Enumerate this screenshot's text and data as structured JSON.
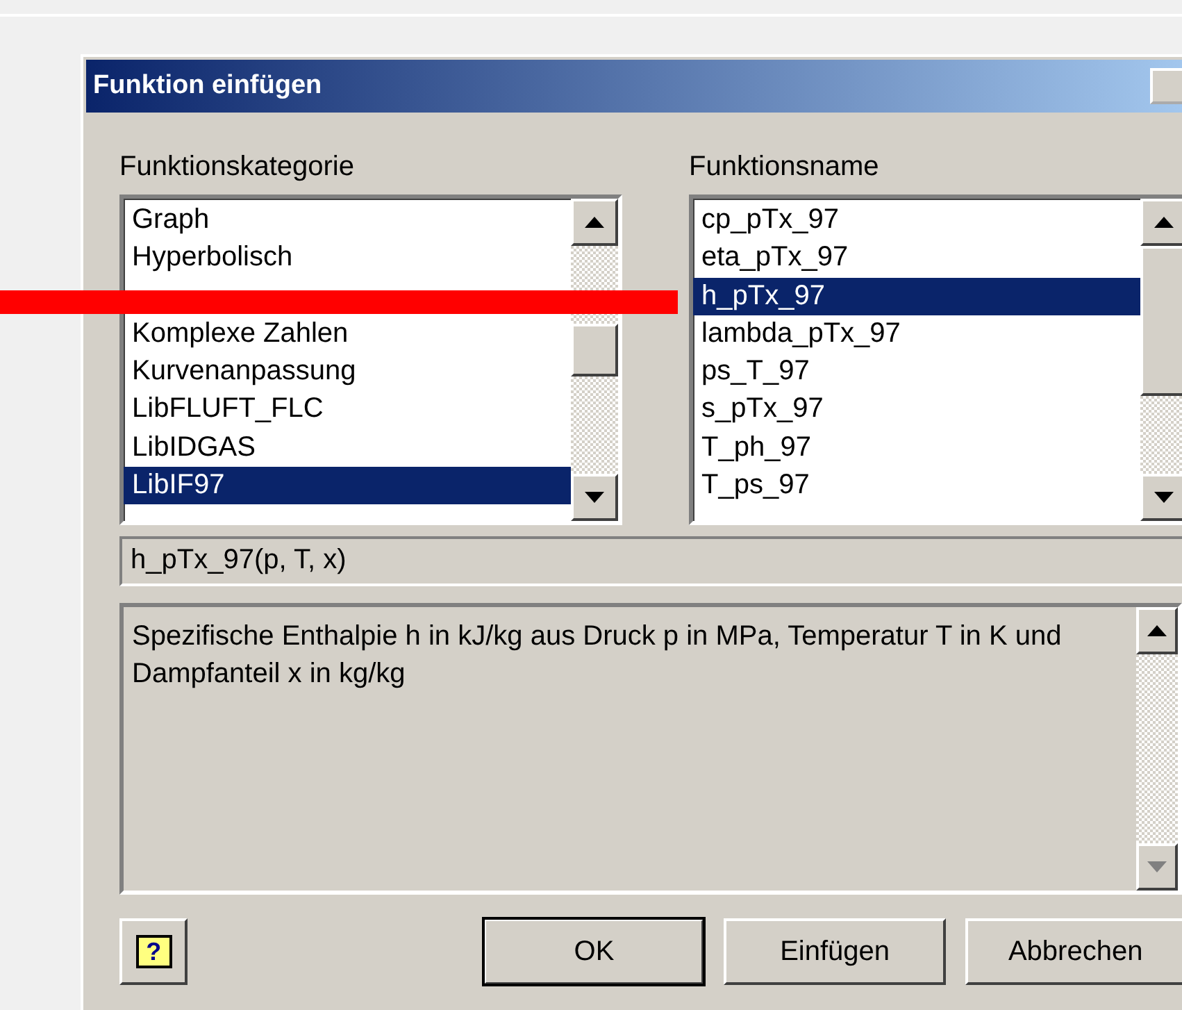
{
  "window": {
    "title": "Funktion einfügen"
  },
  "category_list": {
    "label": "Funktionskategorie",
    "items": [
      {
        "kind": "item",
        "label": "Graph",
        "selected": false
      },
      {
        "kind": "item",
        "label": "Hyperbolisch",
        "selected": false
      },
      {
        "kind": "covered"
      },
      {
        "kind": "item",
        "label": "Komplexe Zahlen",
        "selected": false
      },
      {
        "kind": "item",
        "label": "Kurvenanpassung",
        "selected": false
      },
      {
        "kind": "item",
        "label": "LibFLUFT_FLC",
        "selected": false
      },
      {
        "kind": "item",
        "label": "LibIDGAS",
        "selected": false
      },
      {
        "kind": "item",
        "label": "LibIF97",
        "selected": true
      }
    ]
  },
  "function_list": {
    "label": "Funktionsname",
    "items": [
      {
        "kind": "item",
        "label": "cp_pTx_97",
        "selected": false
      },
      {
        "kind": "item",
        "label": "eta_pTx_97",
        "selected": false
      },
      {
        "kind": "item",
        "label": "h_pTx_97",
        "selected": true
      },
      {
        "kind": "item",
        "label": "lambda_pTx_97",
        "selected": false
      },
      {
        "kind": "item",
        "label": "ps_T_97",
        "selected": false
      },
      {
        "kind": "item",
        "label": "s_pTx_97",
        "selected": false
      },
      {
        "kind": "item",
        "label": "T_ph_97",
        "selected": false
      },
      {
        "kind": "item",
        "label": "T_ps_97",
        "selected": false
      }
    ]
  },
  "signature": "h_pTx_97(p, T, x)",
  "description": "Spezifische Enthalpie h in kJ/kg aus Druck p in MPa, Temperatur T in K und Dampfanteil x in kg/kg",
  "help_button": {
    "symbol": "?"
  },
  "buttons": [
    {
      "label": "OK",
      "default": true
    },
    {
      "label": "Einfügen",
      "default": false
    },
    {
      "label": "Abbrechen",
      "default": false
    }
  ]
}
